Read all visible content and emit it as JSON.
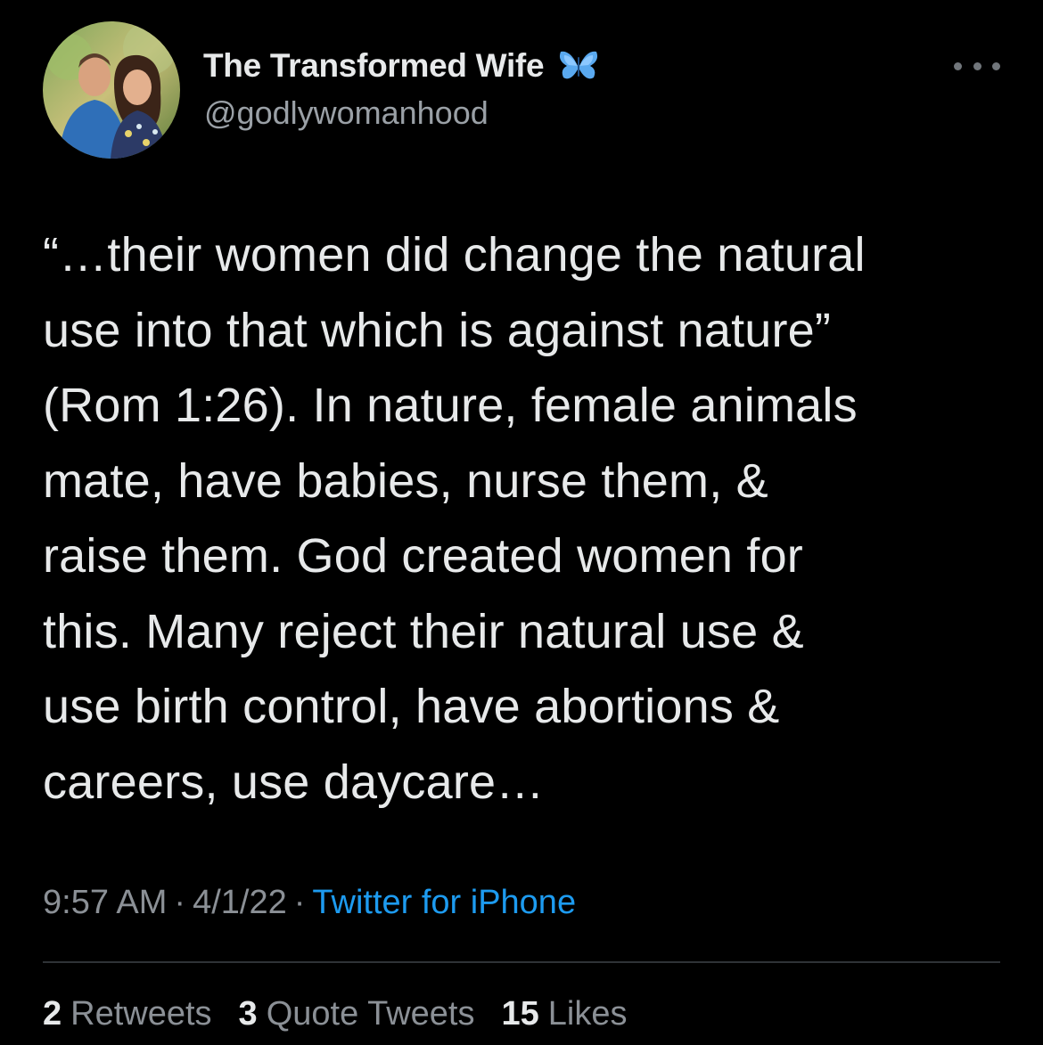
{
  "author": {
    "display_name": "The Transformed Wife",
    "badge_icon": "butterfly-icon",
    "handle": "@godlywomanhood",
    "avatar_icon": "profile-photo"
  },
  "more_icon": "more-options-icon",
  "tweet": {
    "lines": [
      "“…their women did change the natural",
      "use into that which is against nature”",
      "(Rom 1:26). In nature, female animals",
      "mate, have babies, nurse them, &",
      "raise them. God created women for",
      "this. Many reject their natural use &",
      "use birth control, have abortions &",
      "careers, use daycare…"
    ]
  },
  "meta": {
    "time": "9:57 AM",
    "separator": "·",
    "date": "4/1/22",
    "source": "Twitter for iPhone"
  },
  "stats": {
    "retweets_count": "2",
    "retweets_label": "Retweets",
    "quotes_count": "3",
    "quotes_label": "Quote Tweets",
    "likes_count": "15",
    "likes_label": "Likes"
  },
  "colors": {
    "background": "#000000",
    "text": "#e7e9ea",
    "secondary": "#8b9096",
    "link": "#1d9bf0",
    "divider": "#2f3336"
  }
}
